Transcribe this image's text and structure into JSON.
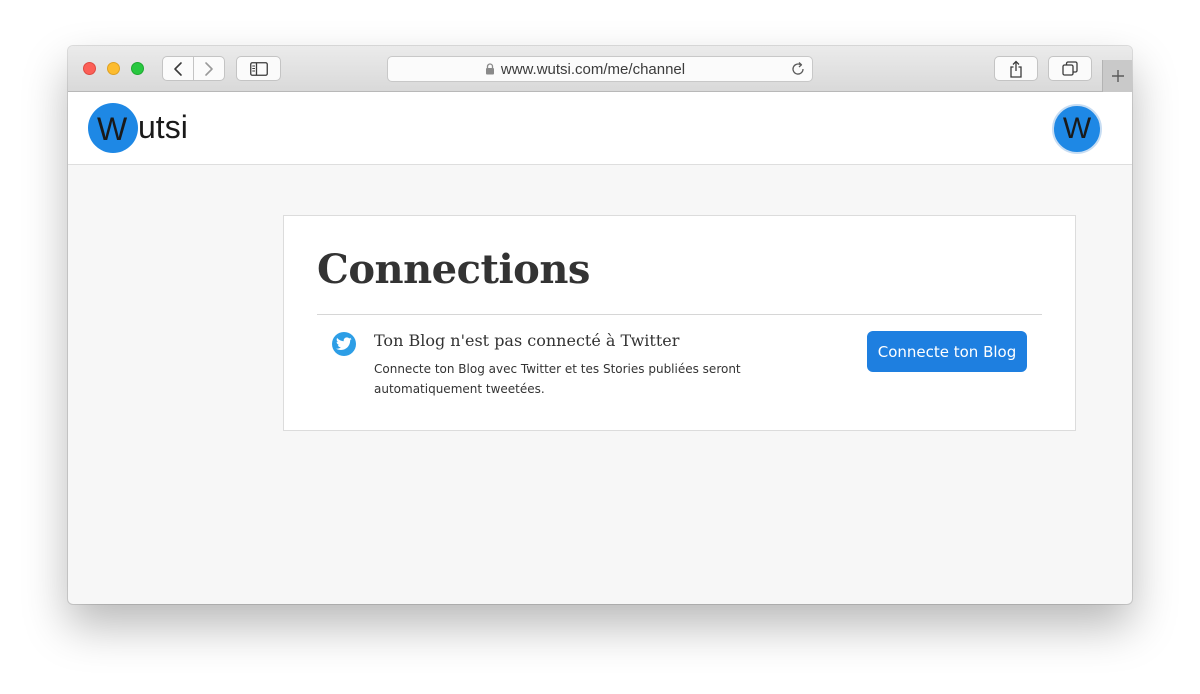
{
  "browser": {
    "url": "www.wutsi.com/me/channel",
    "icons": {
      "back": "chevron-left-icon",
      "forward": "chevron-right-icon",
      "sidebar": "sidebar-icon",
      "lock": "lock-icon",
      "reload": "reload-icon",
      "share": "share-icon",
      "tabs": "tabs-icon",
      "new_tab": "plus-icon"
    }
  },
  "header": {
    "logo_letter": "W",
    "logo_rest": "utsi",
    "avatar_letter": "W"
  },
  "card": {
    "title": "Connections",
    "connection": {
      "icon": "twitter-icon",
      "title": "Ton Blog n'est pas connecté à Twitter",
      "description": "Connecte ton Blog avec Twitter et tes Stories publiées seront automatiquement tweetées.",
      "button_label": "Connecte ton Blog"
    }
  },
  "colors": {
    "brand_blue": "#1e88e5",
    "button_blue": "#1e7fe0",
    "twitter_blue": "#2d9ee6"
  }
}
